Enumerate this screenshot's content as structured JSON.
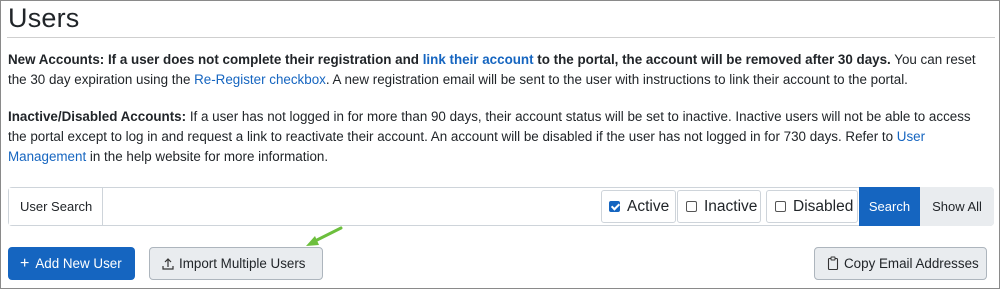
{
  "page": {
    "title": "Users"
  },
  "notices": {
    "new_accounts": {
      "lead": "New Accounts:",
      "part1": " If a user does not complete their registration and ",
      "link1": "link their account",
      "part2": " to the portal, the account will be removed after 30 days.",
      "part3": " You can reset the 30 day expiration using the ",
      "link2": "Re-Register checkbox",
      "part4": ". A new registration email will be sent to the user with instructions to link their account to the portal."
    },
    "inactive_accounts": {
      "lead": "Inactive/Disabled Accounts:",
      "part1": " If a user has not logged in for more than 90 days, their account status will be set to inactive. Inactive users will not be able to access the portal except to log in and request a link to reactivate their account. An account will be disabled if the user has not logged in for 730 days. Refer to ",
      "link1": "User Management",
      "part2": " in the help website for more information."
    }
  },
  "search": {
    "label": "User Search",
    "value": "",
    "placeholder": "",
    "filters": [
      {
        "label": "Active",
        "checked": true
      },
      {
        "label": "Inactive",
        "checked": false
      },
      {
        "label": "Disabled",
        "checked": false
      }
    ],
    "search_button": "Search",
    "show_all_button": "Show All"
  },
  "actions": {
    "add_user": "Add New User",
    "add_icon": "plus-icon",
    "import_users": "Import Multiple Users",
    "import_icon": "upload-icon",
    "copy_emails": "Copy Email Addresses",
    "copy_icon": "clipboard-icon"
  },
  "colors": {
    "primary": "#1565c0",
    "link": "#1565c0",
    "annotation_arrow": "#6cbf3d"
  }
}
